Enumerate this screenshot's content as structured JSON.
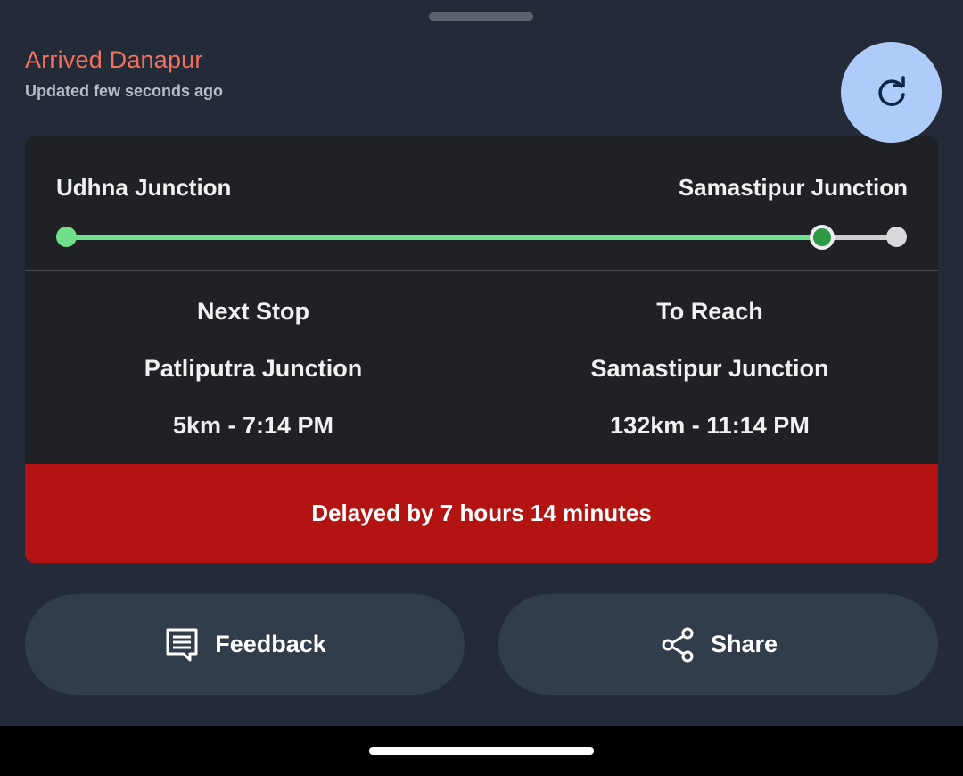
{
  "status": {
    "title": "Arrived Danapur",
    "updated": "Updated few seconds ago"
  },
  "route": {
    "from": "Udhna Junction",
    "to": "Samastipur Junction",
    "progress_fraction": 0.91
  },
  "next_stop": {
    "heading": "Next Stop",
    "station": "Patliputra Junction",
    "eta": "5km - 7:14 PM"
  },
  "destination": {
    "heading": "To Reach",
    "station": "Samastipur Junction",
    "eta": "132km - 11:14 PM"
  },
  "delay": {
    "text": "Delayed by 7 hours 14 minutes",
    "color": "#b31412"
  },
  "actions": {
    "feedback_label": "Feedback",
    "share_label": "Share"
  },
  "icons": {
    "refresh": "refresh-icon",
    "feedback": "feedback-icon",
    "share": "share-icon"
  },
  "colors": {
    "status_accent": "#f2705c",
    "progress_done": "#6ee08c",
    "refresh_button": "#aecbfa"
  }
}
